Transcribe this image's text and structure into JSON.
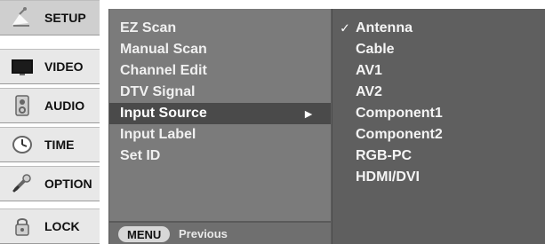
{
  "tabs": [
    {
      "label": "SETUP",
      "icon": "satellite-dish-icon"
    },
    {
      "label": "VIDEO",
      "icon": "monitor-icon"
    },
    {
      "label": "AUDIO",
      "icon": "speaker-icon"
    },
    {
      "label": "TIME",
      "icon": "clock-icon"
    },
    {
      "label": "OPTION",
      "icon": "tools-icon"
    },
    {
      "label": "LOCK",
      "icon": "lock-icon"
    }
  ],
  "setup_menu": {
    "items": [
      {
        "label": "EZ Scan"
      },
      {
        "label": "Manual Scan"
      },
      {
        "label": "Channel Edit"
      },
      {
        "label": "DTV Signal"
      },
      {
        "label": "Input Source",
        "has_submenu": true
      },
      {
        "label": "Input Label"
      },
      {
        "label": "Set ID"
      }
    ],
    "submenu_arrow": "►",
    "footer": {
      "menu_key": "MENU",
      "action_label": "Previous"
    }
  },
  "input_source_menu": {
    "check_mark": "✓",
    "options": [
      {
        "label": "Antenna",
        "checked": true
      },
      {
        "label": "Cable"
      },
      {
        "label": "AV1"
      },
      {
        "label": "AV2"
      },
      {
        "label": "Component1"
      },
      {
        "label": "Component2"
      },
      {
        "label": "RGB-PC"
      },
      {
        "label": "HDMI/DVI"
      }
    ]
  }
}
